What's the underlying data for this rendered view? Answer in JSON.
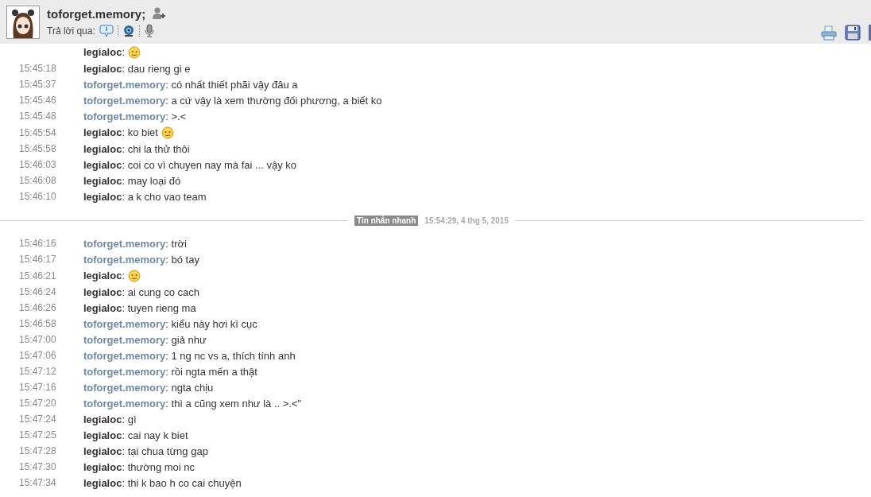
{
  "header": {
    "contact_name": "toforget.memory;",
    "reply_label": "Trả lời qua:"
  },
  "sections": [
    {
      "messages": [
        {
          "sender": "legialoc",
          "kind": "me",
          "text": ":",
          "emoji": true
        },
        {
          "time": "15:45:18",
          "sender": "legialoc",
          "kind": "me",
          "text": ": dau rieng gi e"
        },
        {
          "time": "15:45:37",
          "sender": "toforget.memory",
          "kind": "contact",
          "text": ": có nhất thiết phãi vậy đâu a"
        },
        {
          "time": "15:45:46",
          "sender": "toforget.memory",
          "kind": "contact",
          "text": ": a cứ vậy là xem thường đối phương, a biết ko"
        },
        {
          "time": "15:45:48",
          "sender": "toforget.memory",
          "kind": "contact",
          "text": ": >.<"
        },
        {
          "time": "15:45:54",
          "sender": "legialoc",
          "kind": "me",
          "text": ": ko biet",
          "emoji": true
        },
        {
          "time": "15:45:58",
          "sender": "legialoc",
          "kind": "me",
          "text": ": chi la thử thôi"
        },
        {
          "time": "15:46:03",
          "sender": "legialoc",
          "kind": "me",
          "text": ": coi co vì chuyen nay mà fai ... vậy ko"
        },
        {
          "time": "15:46:08",
          "sender": "legialoc",
          "kind": "me",
          "text": ": may loại đó"
        },
        {
          "time": "15:46:10",
          "sender": "legialoc",
          "kind": "me",
          "text": ": a k cho vao team"
        }
      ]
    },
    {
      "divider": {
        "label": "Tin nhắn nhanh",
        "timestamp": "15:54:29, 4 thg 5, 2015"
      },
      "messages": [
        {
          "time": "15:46:16",
          "sender": "toforget.memory",
          "kind": "contact",
          "text": ": trời"
        },
        {
          "time": "15:46:17",
          "sender": "toforget.memory",
          "kind": "contact",
          "text": ": bó tay"
        },
        {
          "time": "15:46:21",
          "sender": "legialoc",
          "kind": "me",
          "text": ":",
          "emoji": true
        },
        {
          "time": "15:46:24",
          "sender": "legialoc",
          "kind": "me",
          "text": ": ai cung co cach"
        },
        {
          "time": "15:46:26",
          "sender": "legialoc",
          "kind": "me",
          "text": ": tuyen rieng ma"
        },
        {
          "time": "15:46:58",
          "sender": "toforget.memory",
          "kind": "contact",
          "text": ": kiểu này hơi kì cục"
        },
        {
          "time": "15:47:00",
          "sender": "toforget.memory",
          "kind": "contact",
          "text": ": giả như"
        },
        {
          "time": "15:47:06",
          "sender": "toforget.memory",
          "kind": "contact",
          "text": ": 1 ng nc vs a, thích tính anh"
        },
        {
          "time": "15:47:12",
          "sender": "toforget.memory",
          "kind": "contact",
          "text": ": rồi ngta mến a thật"
        },
        {
          "time": "15:47:16",
          "sender": "toforget.memory",
          "kind": "contact",
          "text": ": ngta chịu"
        },
        {
          "time": "15:47:20",
          "sender": "toforget.memory",
          "kind": "contact",
          "text": ": thì a cũng xem như là .. >.<\""
        },
        {
          "time": "15:47:24",
          "sender": "legialoc",
          "kind": "me",
          "text": ": gì"
        },
        {
          "time": "15:47:25",
          "sender": "legialoc",
          "kind": "me",
          "text": ": cai nay k biet"
        },
        {
          "time": "15:47:28",
          "sender": "legialoc",
          "kind": "me",
          "text": ": tại chua từng gap"
        },
        {
          "time": "15:47:30",
          "sender": "legialoc",
          "kind": "me",
          "text": ": thường moi nc"
        },
        {
          "time": "15:47:34",
          "sender": "legialoc",
          "kind": "me",
          "text": ": thi k bao h co cai chuyện"
        }
      ]
    }
  ]
}
